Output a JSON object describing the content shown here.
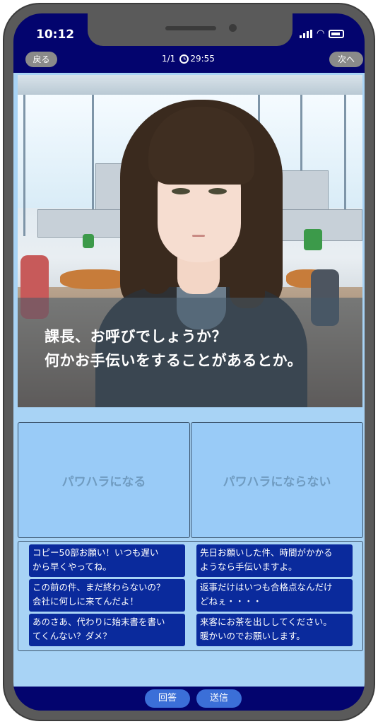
{
  "status": {
    "time": "10:12"
  },
  "nav": {
    "back_label": "戻る",
    "next_label": "次へ",
    "page_counter": "1/1",
    "timer": "29:55"
  },
  "dialogue": {
    "text": "課長、お呼びでしょうか？\n何かお手伝いをすることがあるとか。"
  },
  "choices": {
    "left": "パワハラになる",
    "right": "パワハラにならない"
  },
  "options": [
    "コピー50部お願い！いつも遅い\nから早くやってね。",
    "先日お願いした件、時間がかかる\nようなら手伝いますよ。",
    "この前の件、まだ終わらないの？\n会社に何しに来てんだよ！",
    "返事だけはいつも合格点なんだけ\nどねぇ・・・・",
    "あのさあ、代わりに始末書を書い\nてくんない？ダメ？",
    "来客にお茶を出ししてください。\n暖かいのでお願いします。"
  ],
  "footer": {
    "answer_label": "回答",
    "send_label": "送信"
  },
  "colors": {
    "frame": "#5a5a5a",
    "navy": "#03046e",
    "option_bg": "#0a2a9c",
    "panel_bg": "#a8d3f5",
    "button_blue": "#3b6fd8"
  }
}
